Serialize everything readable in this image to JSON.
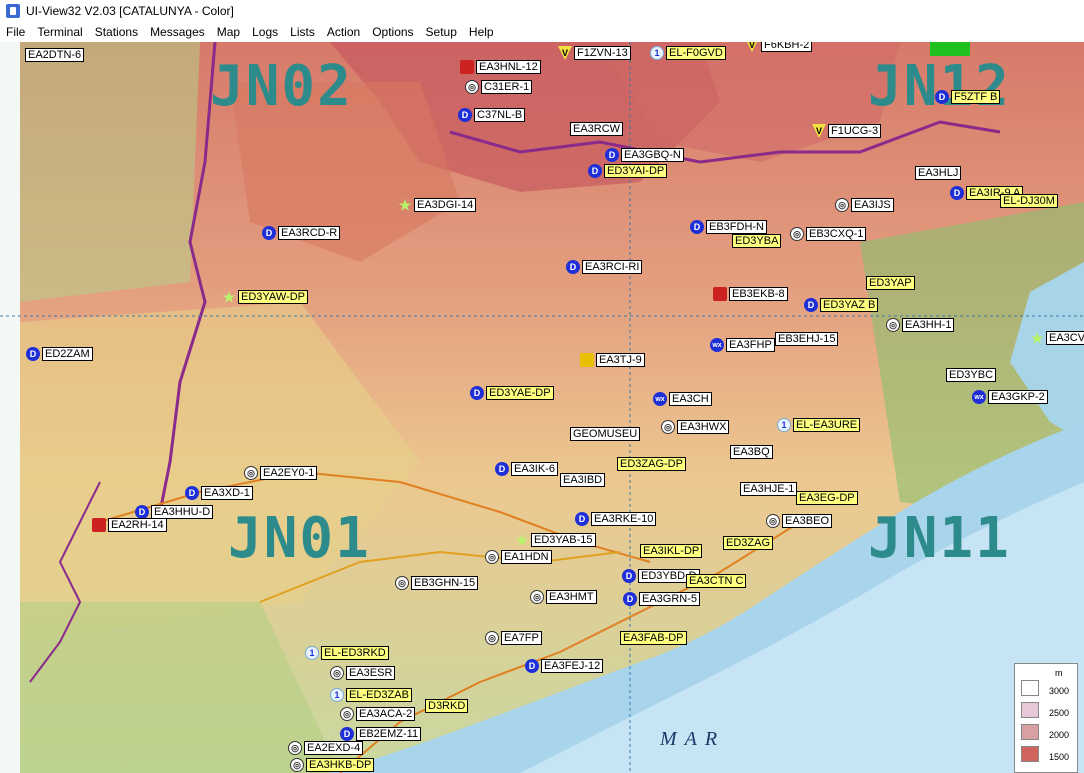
{
  "window": {
    "title": "UI-View32 V2.03 [CATALUNYA - Color]"
  },
  "menu": [
    "File",
    "Terminal",
    "Stations",
    "Messages",
    "Map",
    "Logs",
    "Lists",
    "Action",
    "Options",
    "Setup",
    "Help"
  ],
  "grid_labels": [
    "JN02",
    "JN12",
    "JN01",
    "JN11"
  ],
  "sea_label": "MAR",
  "legend": {
    "unit": "m",
    "levels": [
      {
        "label": "3000",
        "color": "#ffffff"
      },
      {
        "label": "2500",
        "color": "#e6c8d8"
      },
      {
        "label": "2000",
        "color": "#d8a0a0"
      },
      {
        "label": "1500",
        "color": "#d0645c"
      }
    ]
  },
  "stations": [
    {
      "call": "EA2DTN-6",
      "sym": "none",
      "style": "w"
    },
    {
      "call": "EA3HNL-12",
      "sym": "car",
      "style": "w"
    },
    {
      "call": "C31ER-1",
      "sym": "dig",
      "style": "w"
    },
    {
      "call": "C37NL-B",
      "sym": "d",
      "style": "w"
    },
    {
      "call": "F1ZVN-13",
      "sym": "v",
      "style": "w"
    },
    {
      "call": "EL-F0GVD",
      "sym": "num",
      "style": "y"
    },
    {
      "call": "F6KBH-2",
      "sym": "v",
      "style": "w"
    },
    {
      "call": "F5ZTF B",
      "sym": "d",
      "style": "y"
    },
    {
      "call": "F1UCG-3",
      "sym": "v",
      "style": "w"
    },
    {
      "call": "EA3RCW",
      "sym": "none",
      "style": "w"
    },
    {
      "call": "EA3GBQ-N",
      "sym": "d",
      "style": "w"
    },
    {
      "call": "ED3YAI-DP",
      "sym": "d",
      "style": "y"
    },
    {
      "call": "EA3HLJ",
      "sym": "none",
      "style": "w"
    },
    {
      "call": "EA3IR-9 A",
      "sym": "d",
      "style": "y"
    },
    {
      "call": "EL-DJ30M",
      "sym": "none",
      "style": "y"
    },
    {
      "call": "EA3DGI-14",
      "sym": "star",
      "style": "w"
    },
    {
      "call": "EA3IJS",
      "sym": "dig",
      "style": "w"
    },
    {
      "call": "EA3RCD-R",
      "sym": "d",
      "style": "w"
    },
    {
      "call": "EB3FDH-N",
      "sym": "d",
      "style": "w"
    },
    {
      "call": "ED3YBA",
      "sym": "none",
      "style": "y"
    },
    {
      "call": "EB3CXQ-1",
      "sym": "dig",
      "style": "w"
    },
    {
      "call": "EA3RCI-RI",
      "sym": "d",
      "style": "w"
    },
    {
      "call": "ED3YAP",
      "sym": "none",
      "style": "y"
    },
    {
      "call": "ED3YAW-DP",
      "sym": "star",
      "style": "y"
    },
    {
      "call": "EB3EKB-8",
      "sym": "car",
      "style": "w"
    },
    {
      "call": "ED3YAZ B",
      "sym": "d",
      "style": "y"
    },
    {
      "call": "EA3HH-1",
      "sym": "dig",
      "style": "w"
    },
    {
      "call": "EA3CV",
      "sym": "star",
      "style": "w"
    },
    {
      "call": "ED2ZAM",
      "sym": "d",
      "style": "w"
    },
    {
      "call": "EB3EHJ-15",
      "sym": "none",
      "style": "w"
    },
    {
      "call": "EA3FHP",
      "sym": "wx",
      "style": "w"
    },
    {
      "call": "EA3TJ-9",
      "sym": "house",
      "style": "w"
    },
    {
      "call": "ED3YBC",
      "sym": "none",
      "style": "w"
    },
    {
      "call": "EA3GKP-2",
      "sym": "wx",
      "style": "w"
    },
    {
      "call": "ED3YAE-DP",
      "sym": "d",
      "style": "y"
    },
    {
      "call": "EA3CH",
      "sym": "wx",
      "style": "w"
    },
    {
      "call": "GEOMUSEU",
      "sym": "none",
      "style": "w"
    },
    {
      "call": "EA3HWX",
      "sym": "dig",
      "style": "w"
    },
    {
      "call": "EL-EA3URE",
      "sym": "num",
      "style": "y"
    },
    {
      "call": "EA3BQ",
      "sym": "none",
      "style": "w"
    },
    {
      "call": "EA3IK-6",
      "sym": "d",
      "style": "w"
    },
    {
      "call": "EA3IBD",
      "sym": "none",
      "style": "w"
    },
    {
      "call": "ED3ZAG-DP",
      "sym": "none",
      "style": "y"
    },
    {
      "call": "EA2EY0-1",
      "sym": "dig",
      "style": "w"
    },
    {
      "call": "EA3XD-1",
      "sym": "d",
      "style": "w"
    },
    {
      "call": "EA3HJE-1",
      "sym": "none",
      "style": "w"
    },
    {
      "call": "EA3EG-DP",
      "sym": "none",
      "style": "y"
    },
    {
      "call": "EA3HHU-D",
      "sym": "d",
      "style": "w"
    },
    {
      "call": "EA3RKE-10",
      "sym": "d",
      "style": "w"
    },
    {
      "call": "EA3BEO",
      "sym": "dig",
      "style": "w"
    },
    {
      "call": "EA2RH-14",
      "sym": "car",
      "style": "w"
    },
    {
      "call": "ED3YAB-15",
      "sym": "star",
      "style": "w"
    },
    {
      "call": "EA3IKL-DP",
      "sym": "none",
      "style": "y"
    },
    {
      "call": "ED3ZAG",
      "sym": "none",
      "style": "y"
    },
    {
      "call": "EA1HDN",
      "sym": "dig",
      "style": "w"
    },
    {
      "call": "ED3YBD-D",
      "sym": "d",
      "style": "w"
    },
    {
      "call": "EA3CTN C",
      "sym": "none",
      "style": "y"
    },
    {
      "call": "EB3GHN-15",
      "sym": "dig",
      "style": "w"
    },
    {
      "call": "EA3GRN-5",
      "sym": "d",
      "style": "w"
    },
    {
      "call": "EA3HMT",
      "sym": "dig",
      "style": "w"
    },
    {
      "call": "EA7FP",
      "sym": "dig",
      "style": "w"
    },
    {
      "call": "EA3FAB-DP",
      "sym": "none",
      "style": "y"
    },
    {
      "call": "EL-ED3RKD",
      "sym": "num",
      "style": "y"
    },
    {
      "call": "EA3FEJ-12",
      "sym": "d",
      "style": "w"
    },
    {
      "call": "EA3ESR",
      "sym": "dig",
      "style": "w"
    },
    {
      "call": "EL-ED3ZAB",
      "sym": "num",
      "style": "y"
    },
    {
      "call": "EA3ACA-2",
      "sym": "dig",
      "style": "w"
    },
    {
      "call": "D3RKD",
      "sym": "none",
      "style": "y"
    },
    {
      "call": "EB2EMZ-11",
      "sym": "d",
      "style": "w"
    },
    {
      "call": "EA2EXD-4",
      "sym": "dig",
      "style": "w"
    },
    {
      "call": "EA3HKB-DP",
      "sym": "dig",
      "style": "y"
    }
  ]
}
